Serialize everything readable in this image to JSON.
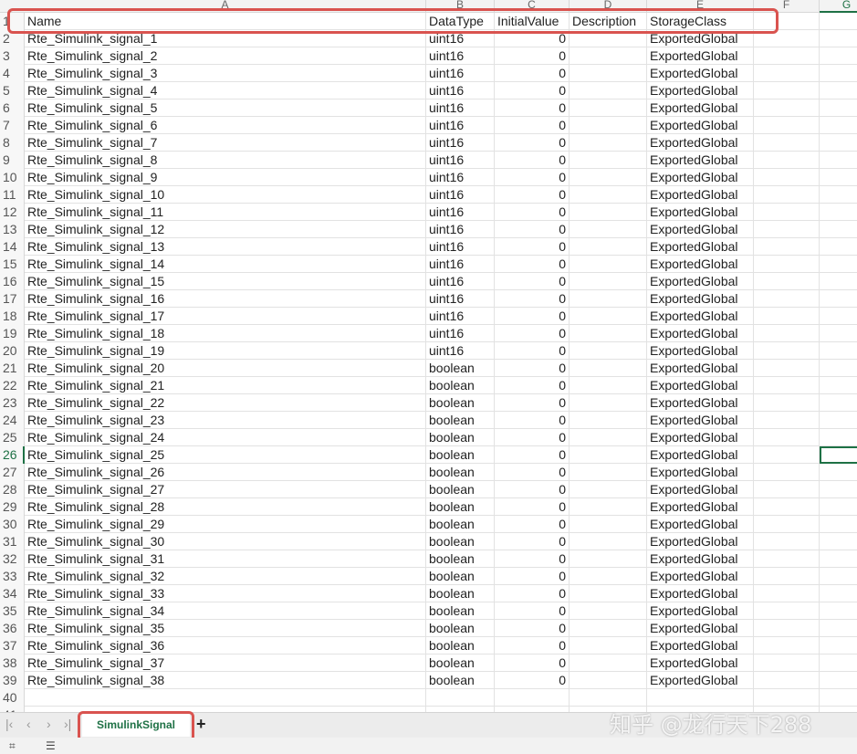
{
  "columns": [
    "A",
    "B",
    "C",
    "D",
    "E",
    "F",
    "G"
  ],
  "selected_cell": "G26",
  "header_row": [
    "Name",
    "DataType",
    "InitialValue",
    "Description",
    "StorageClass"
  ],
  "rows": [
    [
      "Rte_Simulink_signal_1",
      "uint16",
      "0",
      "",
      "ExportedGlobal"
    ],
    [
      "Rte_Simulink_signal_2",
      "uint16",
      "0",
      "",
      "ExportedGlobal"
    ],
    [
      "Rte_Simulink_signal_3",
      "uint16",
      "0",
      "",
      "ExportedGlobal"
    ],
    [
      "Rte_Simulink_signal_4",
      "uint16",
      "0",
      "",
      "ExportedGlobal"
    ],
    [
      "Rte_Simulink_signal_5",
      "uint16",
      "0",
      "",
      "ExportedGlobal"
    ],
    [
      "Rte_Simulink_signal_6",
      "uint16",
      "0",
      "",
      "ExportedGlobal"
    ],
    [
      "Rte_Simulink_signal_7",
      "uint16",
      "0",
      "",
      "ExportedGlobal"
    ],
    [
      "Rte_Simulink_signal_8",
      "uint16",
      "0",
      "",
      "ExportedGlobal"
    ],
    [
      "Rte_Simulink_signal_9",
      "uint16",
      "0",
      "",
      "ExportedGlobal"
    ],
    [
      "Rte_Simulink_signal_10",
      "uint16",
      "0",
      "",
      "ExportedGlobal"
    ],
    [
      "Rte_Simulink_signal_11",
      "uint16",
      "0",
      "",
      "ExportedGlobal"
    ],
    [
      "Rte_Simulink_signal_12",
      "uint16",
      "0",
      "",
      "ExportedGlobal"
    ],
    [
      "Rte_Simulink_signal_13",
      "uint16",
      "0",
      "",
      "ExportedGlobal"
    ],
    [
      "Rte_Simulink_signal_14",
      "uint16",
      "0",
      "",
      "ExportedGlobal"
    ],
    [
      "Rte_Simulink_signal_15",
      "uint16",
      "0",
      "",
      "ExportedGlobal"
    ],
    [
      "Rte_Simulink_signal_16",
      "uint16",
      "0",
      "",
      "ExportedGlobal"
    ],
    [
      "Rte_Simulink_signal_17",
      "uint16",
      "0",
      "",
      "ExportedGlobal"
    ],
    [
      "Rte_Simulink_signal_18",
      "uint16",
      "0",
      "",
      "ExportedGlobal"
    ],
    [
      "Rte_Simulink_signal_19",
      "uint16",
      "0",
      "",
      "ExportedGlobal"
    ],
    [
      "Rte_Simulink_signal_20",
      "boolean",
      "0",
      "",
      "ExportedGlobal"
    ],
    [
      "Rte_Simulink_signal_21",
      "boolean",
      "0",
      "",
      "ExportedGlobal"
    ],
    [
      "Rte_Simulink_signal_22",
      "boolean",
      "0",
      "",
      "ExportedGlobal"
    ],
    [
      "Rte_Simulink_signal_23",
      "boolean",
      "0",
      "",
      "ExportedGlobal"
    ],
    [
      "Rte_Simulink_signal_24",
      "boolean",
      "0",
      "",
      "ExportedGlobal"
    ],
    [
      "Rte_Simulink_signal_25",
      "boolean",
      "0",
      "",
      "ExportedGlobal"
    ],
    [
      "Rte_Simulink_signal_26",
      "boolean",
      "0",
      "",
      "ExportedGlobal"
    ],
    [
      "Rte_Simulink_signal_27",
      "boolean",
      "0",
      "",
      "ExportedGlobal"
    ],
    [
      "Rte_Simulink_signal_28",
      "boolean",
      "0",
      "",
      "ExportedGlobal"
    ],
    [
      "Rte_Simulink_signal_29",
      "boolean",
      "0",
      "",
      "ExportedGlobal"
    ],
    [
      "Rte_Simulink_signal_30",
      "boolean",
      "0",
      "",
      "ExportedGlobal"
    ],
    [
      "Rte_Simulink_signal_31",
      "boolean",
      "0",
      "",
      "ExportedGlobal"
    ],
    [
      "Rte_Simulink_signal_32",
      "boolean",
      "0",
      "",
      "ExportedGlobal"
    ],
    [
      "Rte_Simulink_signal_33",
      "boolean",
      "0",
      "",
      "ExportedGlobal"
    ],
    [
      "Rte_Simulink_signal_34",
      "boolean",
      "0",
      "",
      "ExportedGlobal"
    ],
    [
      "Rte_Simulink_signal_35",
      "boolean",
      "0",
      "",
      "ExportedGlobal"
    ],
    [
      "Rte_Simulink_signal_36",
      "boolean",
      "0",
      "",
      "ExportedGlobal"
    ],
    [
      "Rte_Simulink_signal_37",
      "boolean",
      "0",
      "",
      "ExportedGlobal"
    ],
    [
      "Rte_Simulink_signal_38",
      "boolean",
      "0",
      "",
      "ExportedGlobal"
    ]
  ],
  "sheet_tab": "SimulinkSignal",
  "add_sheet": "+",
  "nav_icons": [
    "first-sheet-icon",
    "prev-sheet-icon",
    "next-sheet-icon",
    "last-sheet-icon"
  ],
  "watermark": "知乎 @龙行天下288",
  "colors": {
    "accent": "#1e7145",
    "highlight": "#d9534f"
  }
}
